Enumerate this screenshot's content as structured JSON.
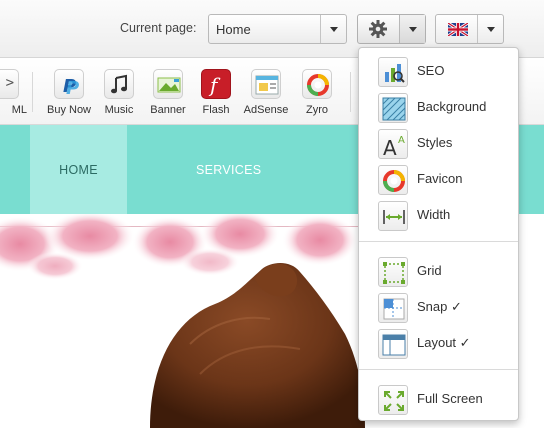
{
  "header": {
    "current_page_label": "Current page:",
    "current_page_value": "Home",
    "language_flag": "uk-flag-icon"
  },
  "toolbar": {
    "partial_label": "ML",
    "partial_icon_text": ">",
    "items": [
      {
        "label": "Buy Now",
        "icon": "paypal-icon"
      },
      {
        "label": "Music",
        "icon": "music-note-icon"
      },
      {
        "label": "Banner",
        "icon": "banner-icon"
      },
      {
        "label": "Flash",
        "icon": "flash-icon"
      },
      {
        "label": "AdSense",
        "icon": "adsense-icon"
      },
      {
        "label": "Zyro",
        "icon": "zyro-icon"
      }
    ]
  },
  "nav": {
    "items": [
      {
        "label": "HOME",
        "active": true
      },
      {
        "label": "SERVICES",
        "active": false
      }
    ]
  },
  "settings_menu": {
    "items": [
      {
        "label": "SEO",
        "icon": "seo-chart-icon"
      },
      {
        "label": "Background",
        "icon": "background-pattern-icon"
      },
      {
        "label": "Styles",
        "icon": "font-styles-icon"
      },
      {
        "label": "Favicon",
        "icon": "favicon-icon"
      },
      {
        "label": "Width",
        "icon": "width-arrows-icon"
      },
      {
        "label": "Grid",
        "icon": "grid-icon"
      },
      {
        "label": "Snap ✓",
        "icon": "snap-icon"
      },
      {
        "label": "Layout ✓",
        "icon": "layout-icon"
      },
      {
        "label": "Full Screen",
        "icon": "fullscreen-icon"
      }
    ]
  },
  "colors": {
    "nav_bg": "#79ddd0",
    "nav_active_bg": "#a7ebe2",
    "flash_red": "#c81e28",
    "paypal_blue": "#1d5ea8"
  }
}
